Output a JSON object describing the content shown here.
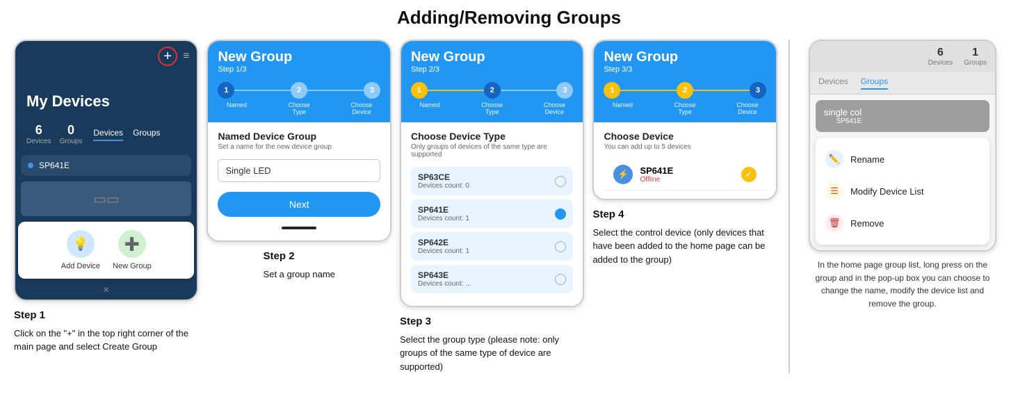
{
  "page": {
    "title": "Adding/Removing Groups"
  },
  "step1": {
    "label": "Step 1",
    "desc": "Click on the \"+\" in the top right corner of the main page and select Create Group",
    "myDevices": "My Devices",
    "devicesCount": "6",
    "groupsCount": "0",
    "devicesLabel": "Devices",
    "groupsLabel": "Groups",
    "tab1": "Devices",
    "tab2": "Groups",
    "deviceName": "SP641E",
    "addDeviceLabel": "Add Device",
    "newGroupLabel": "New Group",
    "closeLabel": "×"
  },
  "step2": {
    "label": "Step 2",
    "desc": "Set a group name",
    "headerTitle": "New Group",
    "stepLabel": "Step 1/3",
    "steps": [
      "1",
      "2",
      "3"
    ],
    "stepNames": [
      "Named",
      "Choose Type",
      "Choose Device"
    ],
    "sectionTitle": "Named Device Group",
    "sectionSub": "Set a name for the new device group",
    "inputValue": "Single LED",
    "nextLabel": "Next"
  },
  "step3": {
    "label": "Step 3",
    "desc": "Select the group type (please note: only groups of the same type of device are supported)",
    "headerTitle": "New Group",
    "stepLabel": "Step 2/3",
    "sectionTitle": "Choose Device Type",
    "sectionSub": "Only groups of devices of the same type are supported",
    "devices": [
      {
        "name": "SP63CE",
        "count": "Devices count: 0"
      },
      {
        "name": "SP641E",
        "count": "Devices count: 1"
      },
      {
        "name": "SP642E",
        "count": "Devices count: 1"
      },
      {
        "name": "SP643E",
        "count": "Devices count: ..."
      }
    ]
  },
  "step4": {
    "label": "Step 4",
    "desc": "Select the control device (only devices that have been added to the home page can be added to the group)",
    "headerTitle": "New Group",
    "stepLabel": "Step 3/3",
    "sectionTitle": "Choose Device",
    "sectionSub": "You can add up to 5 devices",
    "deviceName": "SP641E",
    "deviceStatus": "Offline"
  },
  "step5": {
    "devicesCount": "6",
    "groupsCount": "1",
    "devicesLabel": "Devices",
    "groupsLabel": "Groups",
    "tab1": "Devices",
    "tab2": "Groups",
    "deviceName": "single col",
    "deviceLabel": "SP641E",
    "menu": {
      "rename": "Rename",
      "modifyDeviceList": "Modify Device List",
      "remove": "Remove"
    },
    "desc": "In the home page group list, long press on the group and in the pop-up box you can choose to change the name, modify the device list and remove the group."
  }
}
